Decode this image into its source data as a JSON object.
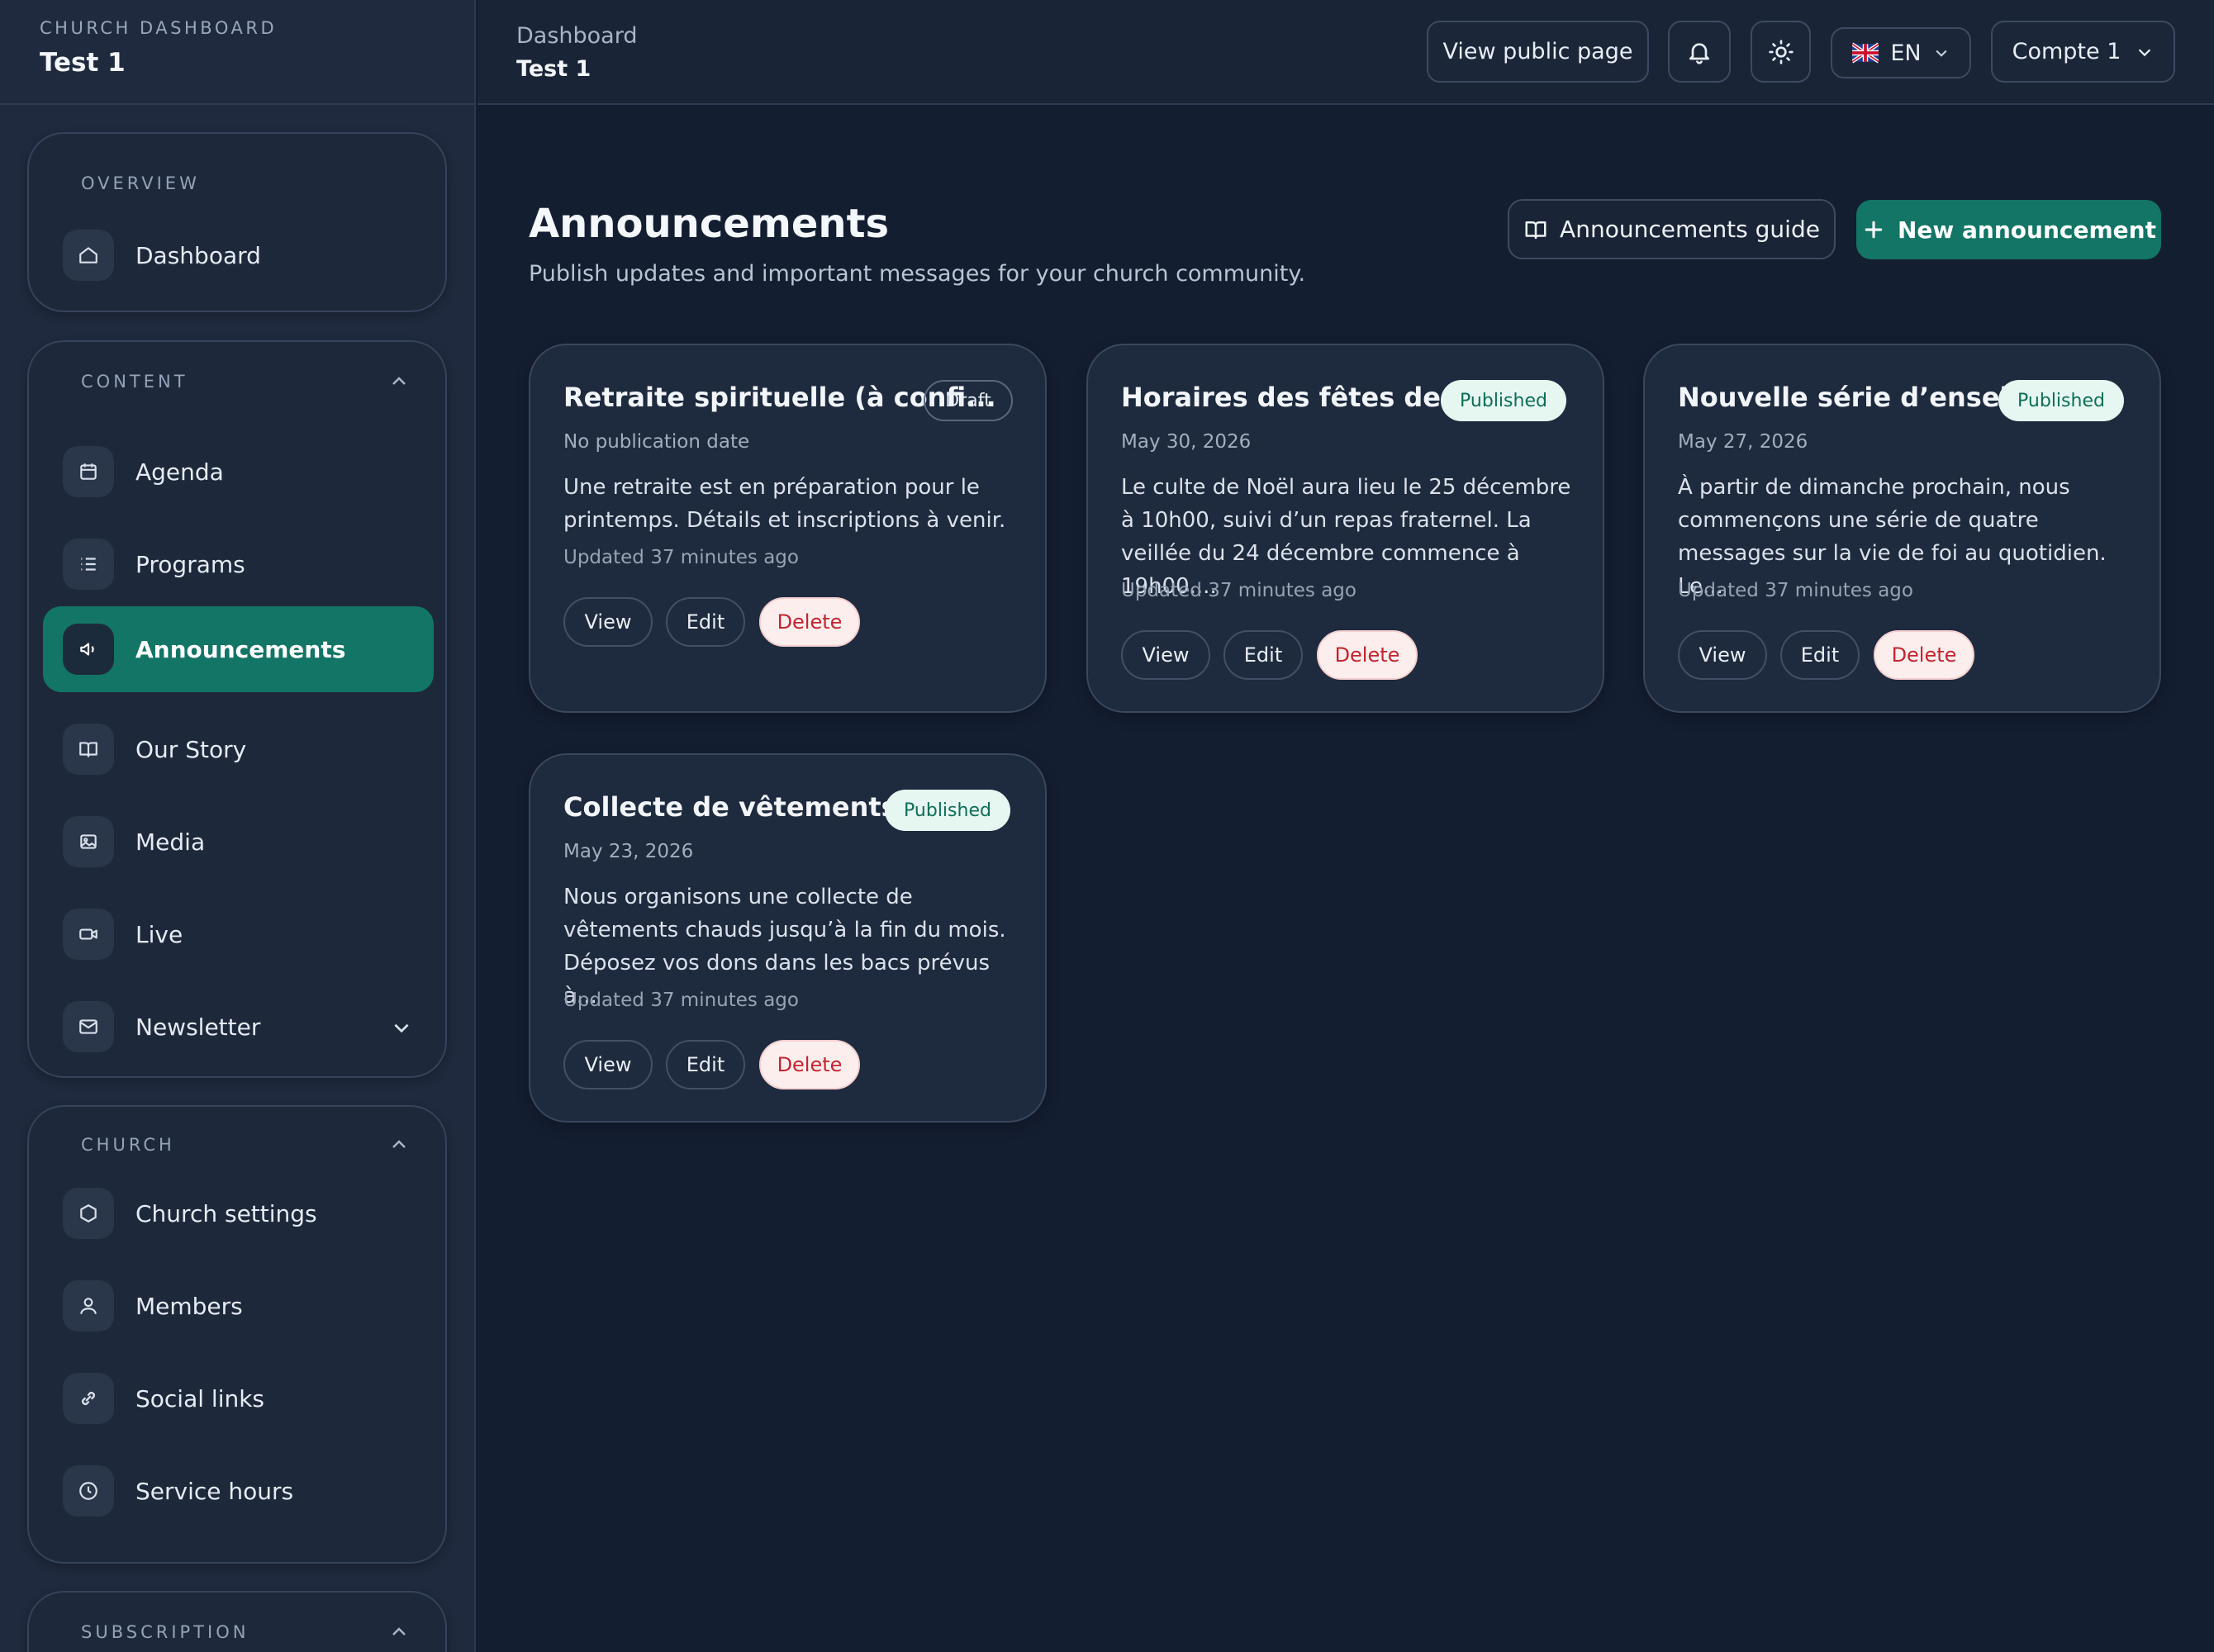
{
  "sidebar": {
    "kicker": "CHURCH DASHBOARD",
    "title": "Test 1",
    "overview": {
      "label": "OVERVIEW",
      "items": [
        {
          "label": "Dashboard",
          "icon": "home-icon"
        }
      ]
    },
    "content": {
      "label": "CONTENT",
      "items": [
        {
          "label": "Agenda",
          "icon": "calendar-icon"
        },
        {
          "label": "Programs",
          "icon": "list-icon"
        },
        {
          "label": "Announcements",
          "icon": "megaphone-icon",
          "active": true
        },
        {
          "label": "Our Story",
          "icon": "book-open-icon"
        },
        {
          "label": "Media",
          "icon": "image-icon"
        },
        {
          "label": "Live",
          "icon": "video-icon"
        },
        {
          "label": "Newsletter",
          "icon": "mail-icon"
        }
      ]
    },
    "church": {
      "label": "CHURCH",
      "items": [
        {
          "label": "Church settings",
          "icon": "hexagon-icon"
        },
        {
          "label": "Members",
          "icon": "user-icon"
        },
        {
          "label": "Social links",
          "icon": "link-icon"
        },
        {
          "label": "Service hours",
          "icon": "clock-icon"
        }
      ]
    },
    "subscription": {
      "label": "SUBSCRIPTION"
    }
  },
  "topbar": {
    "breadcrumb": "Dashboard",
    "subtitle": "Test 1",
    "view_public": "View public page",
    "language": "EN",
    "account": "Compte 1"
  },
  "main": {
    "title": "Announcements",
    "subtitle": "Publish updates and important messages for your church community.",
    "guide_label": "Announcements guide",
    "new_label": "New announcement",
    "cards": [
      {
        "title": "Retraite spirituelle (à confi...",
        "status": "Draft",
        "date": "No publication date",
        "body": "Une retraite est en préparation pour le printemps. Détails et inscriptions à venir.",
        "updated": "Updated 37 minutes ago"
      },
      {
        "title": "Horaires des fêtes de ...",
        "status": "Published",
        "date": "May 30, 2026",
        "body": "Le culte de Noël aura lieu le 25 décembre à 10h00, suivi d’un repas fraternel. La veillée du 24 décembre commence à 19h00....",
        "updated": "Updated 37 minutes ago"
      },
      {
        "title": "Nouvelle série d’enseig...",
        "status": "Published",
        "date": "May 27, 2026",
        "body": "À partir de dimanche prochain, nous commençons une série de quatre messages sur la vie de foi au quotidien. Le...",
        "updated": "Updated 37 minutes ago"
      },
      {
        "title": "Collecte de vêtements ...",
        "status": "Published",
        "date": "May 23, 2026",
        "body": "Nous organisons une collecte de vêtements chauds jusqu’à la fin du mois. Déposez vos dons dans les bacs prévus à...",
        "updated": "Updated 37 minutes ago"
      }
    ],
    "actions": {
      "view": "View",
      "edit": "Edit",
      "delete": "Delete"
    }
  },
  "colors": {
    "accent": "#127565",
    "background": "#141e31",
    "danger": "#c3242f",
    "published_badge": "#e6f7f1"
  }
}
